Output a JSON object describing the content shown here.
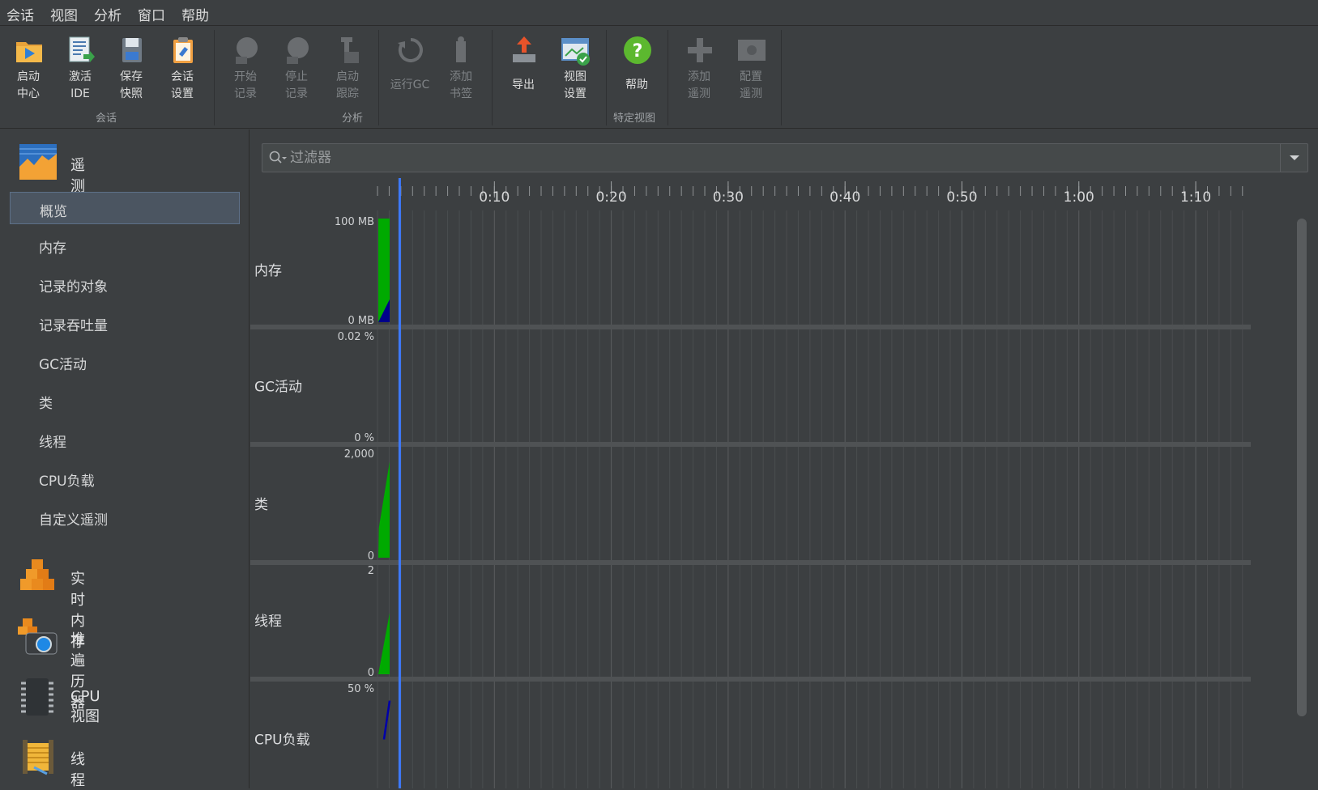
{
  "menu": [
    "会话",
    "视图",
    "分析",
    "窗口",
    "帮助"
  ],
  "toolbar": {
    "buttons": [
      {
        "id": "start-center",
        "label": "启动\n中心",
        "icon": "start-center-icon",
        "enabled": true
      },
      {
        "id": "attach-ide",
        "label": "激活\nIDE",
        "icon": "ide-icon",
        "enabled": true
      },
      {
        "id": "save-snapshot",
        "label": "保存\n快照",
        "icon": "save-icon",
        "enabled": true
      },
      {
        "id": "session-settings",
        "label": "会话\n设置",
        "icon": "clipboard-icon",
        "enabled": true
      },
      {
        "id": "start-recording",
        "label": "开始\n记录",
        "icon": "record-icon",
        "enabled": false
      },
      {
        "id": "stop-recording",
        "label": "停止\n记录",
        "icon": "stop-record-icon",
        "enabled": false
      },
      {
        "id": "start-tracking",
        "label": "启动\n跟踪",
        "icon": "tracking-icon",
        "enabled": false
      },
      {
        "id": "run-gc",
        "label": "运行GC",
        "icon": "gc-icon",
        "enabled": false
      },
      {
        "id": "add-bookmark",
        "label": "添加\n书签",
        "icon": "bookmark-icon",
        "enabled": false
      },
      {
        "id": "export",
        "label": "导出",
        "icon": "export-icon",
        "enabled": true
      },
      {
        "id": "view-settings",
        "label": "视图\n设置",
        "icon": "view-settings-icon",
        "enabled": true
      },
      {
        "id": "help",
        "label": "帮助",
        "icon": "help-icon",
        "enabled": true
      },
      {
        "id": "add-telemetry",
        "label": "添加\n遥测",
        "icon": "plus-icon",
        "enabled": false
      },
      {
        "id": "configure-telemetry",
        "label": "配置\n遥测",
        "icon": "configure-icon",
        "enabled": false
      }
    ],
    "groups": [
      "会话",
      "分析",
      "特定视图"
    ]
  },
  "sidebar": {
    "sections": [
      {
        "label": "遥测",
        "icon": "telemetry-icon"
      },
      {
        "label": "实时内存",
        "icon": "live-memory-icon"
      },
      {
        "label": "堆遍历器",
        "icon": "heap-walker-icon"
      },
      {
        "label": "CPU视图",
        "icon": "cpu-chip-icon"
      },
      {
        "label": "线程",
        "icon": "threads-icon"
      }
    ],
    "items": [
      "概览",
      "内存",
      "记录的对象",
      "记录吞吐量",
      "GC活动",
      "类",
      "线程",
      "CPU负载",
      "自定义遥测"
    ],
    "selected": "概览"
  },
  "filter": {
    "placeholder": "过滤器"
  },
  "timeline": {
    "ticks": [
      "0:10",
      "0:20",
      "0:30",
      "0:40",
      "0:50",
      "1:00",
      "1:10"
    ],
    "tick_seconds": [
      10,
      20,
      30,
      40,
      50,
      60,
      70
    ],
    "max_seconds": 74.5,
    "cursor_seconds": 1.9
  },
  "chart_data": [
    {
      "type": "area",
      "title": "内存",
      "ylim": [
        0,
        100
      ],
      "y_labels": [
        "100 MB",
        "0 MB"
      ],
      "series": [
        {
          "color": "#00aa00",
          "x": [
            0,
            1
          ],
          "y": [
            100,
            100
          ]
        },
        {
          "color": "#00008b",
          "x": [
            0,
            1
          ],
          "y": [
            0,
            22
          ]
        }
      ]
    },
    {
      "type": "area",
      "title": "GC活动",
      "ylim": [
        0,
        0.02
      ],
      "y_labels": [
        "0.02 %",
        "0 %"
      ],
      "series": [
        {
          "color": "#00aa00",
          "x": [
            0,
            1
          ],
          "y": [
            0,
            0
          ]
        }
      ]
    },
    {
      "type": "area",
      "title": "类",
      "ylim": [
        0,
        2000
      ],
      "y_labels": [
        "2,000",
        "0"
      ],
      "series": [
        {
          "color": "#00aa00",
          "x": [
            0,
            0.05,
            1
          ],
          "y": [
            0,
            560,
            1800
          ]
        },
        {
          "color": "#00008b",
          "x": [
            0,
            1
          ],
          "y": [
            0,
            0
          ]
        }
      ]
    },
    {
      "type": "area",
      "title": "线程",
      "ylim": [
        0,
        2
      ],
      "y_labels": [
        "2",
        "0"
      ],
      "series": [
        {
          "color": "#00aa00",
          "x": [
            0,
            1
          ],
          "y": [
            0,
            1.15
          ]
        }
      ]
    },
    {
      "type": "line",
      "title": "CPU负载",
      "ylim": [
        0,
        50
      ],
      "y_labels": [
        "50 %"
      ],
      "series": [
        {
          "color": "#0000aa",
          "x": [
            0.5,
            1
          ],
          "y": [
            25,
            43
          ]
        }
      ]
    }
  ],
  "colors": {
    "cursor": "#3d7aff",
    "grid": "#555859",
    "separator": "#4f5254"
  }
}
